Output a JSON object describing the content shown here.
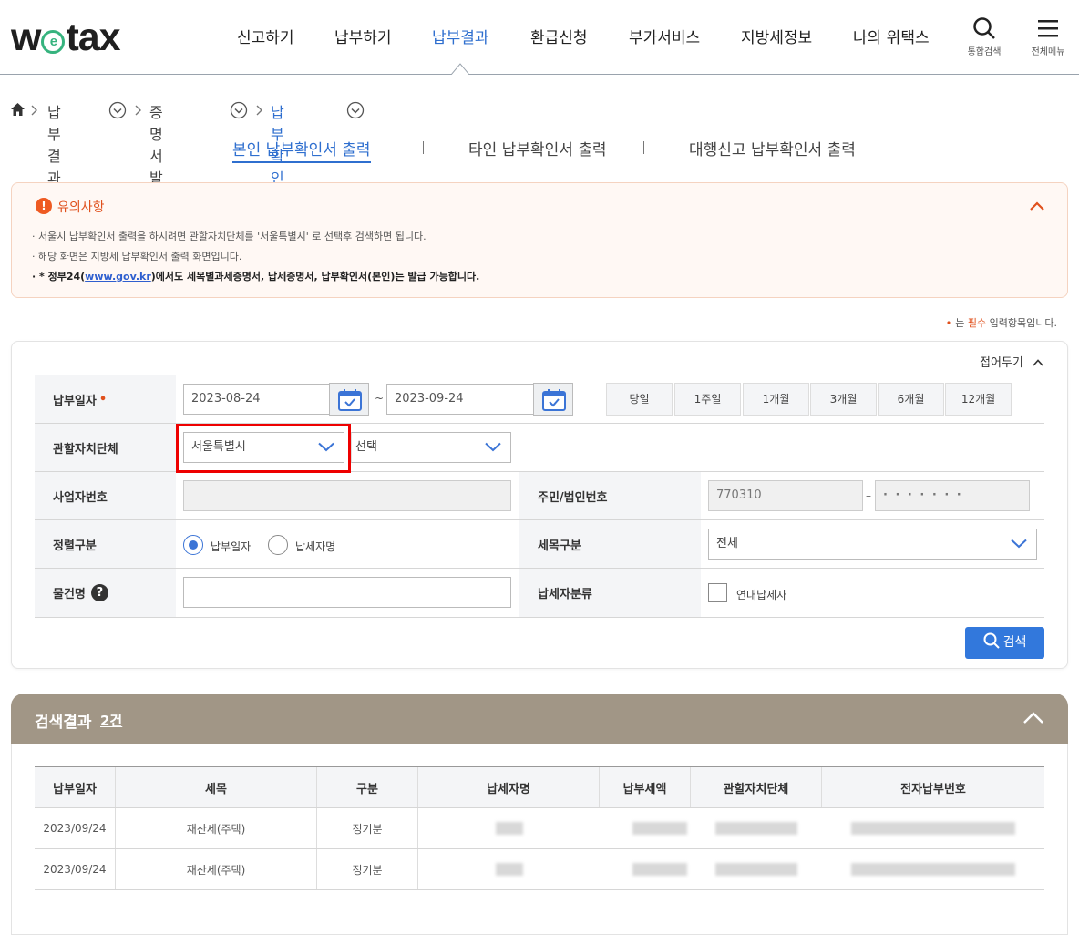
{
  "header": {
    "logo": "wetax",
    "logo_ring": "e",
    "menu": [
      "신고하기",
      "납부하기",
      "납부결과",
      "환급신청",
      "부가서비스",
      "지방세정보",
      "나의 위택스"
    ],
    "search_label": "통합검색",
    "allmenu_label": "전체메뉴"
  },
  "breadcrumb": {
    "items": [
      "납부결과",
      "증명서 발급",
      "납부확인서"
    ]
  },
  "tabs": [
    "본인 납부확인서 출력",
    "타인 납부확인서 출력",
    "대행신고 납부확인서 출력"
  ],
  "notice": {
    "title": "유의사항",
    "line1": "· 서울시 납부확인서 출력을 하시려면 관할자치단체를 '서울특별시' 로 선택후 검색하면 됩니다.",
    "line2": "· 해당 화면은 지방세 납부확인서 출력 화면입니다.",
    "line3_pre": "· * 정부24(",
    "line3_link": "www.gov.kr",
    "line3_post": ")에서도 세목별과세증명서, 납세증명서, 납부확인서(본인)는 발급 가능합니다."
  },
  "required_note": {
    "dot": "•",
    "pre": "는 ",
    "req": "필수",
    "post": " 입력항목입니다."
  },
  "form": {
    "fold": "접어두기",
    "pay_date_label": "납부일자",
    "date_from": "2023-08-24",
    "tilde": "~",
    "date_to": "2023-09-24",
    "periods": [
      "당일",
      "1주일",
      "1개월",
      "3개월",
      "6개월",
      "12개월"
    ],
    "region_label": "관할자치단체",
    "region_value": "서울특별시",
    "region2_value": "선택",
    "bizno_label": "사업자번호",
    "resident_label": "주민/법인번호",
    "resident_front": "770310",
    "dash": "–",
    "resident_back": "· · · · · · ·",
    "sort_label": "정렬구분",
    "sort_opt1": "납부일자",
    "sort_opt2": "납세자명",
    "taxitem_label": "세목구분",
    "taxitem_value": "전체",
    "item_label": "물건명",
    "taxpayer_label": "납세자분류",
    "joint_label": "연대납세자",
    "search_btn": "검색"
  },
  "results": {
    "title": "검색결과",
    "count": "2건",
    "columns": [
      "납부일자",
      "세목",
      "구분",
      "납세자명",
      "납부세액",
      "관할자치단체",
      "전자납부번호"
    ],
    "rows": [
      [
        "2023/09/24",
        "재산세(주택)",
        "정기분"
      ],
      [
        "2023/09/24",
        "재산세(주택)",
        "정기분"
      ]
    ]
  }
}
